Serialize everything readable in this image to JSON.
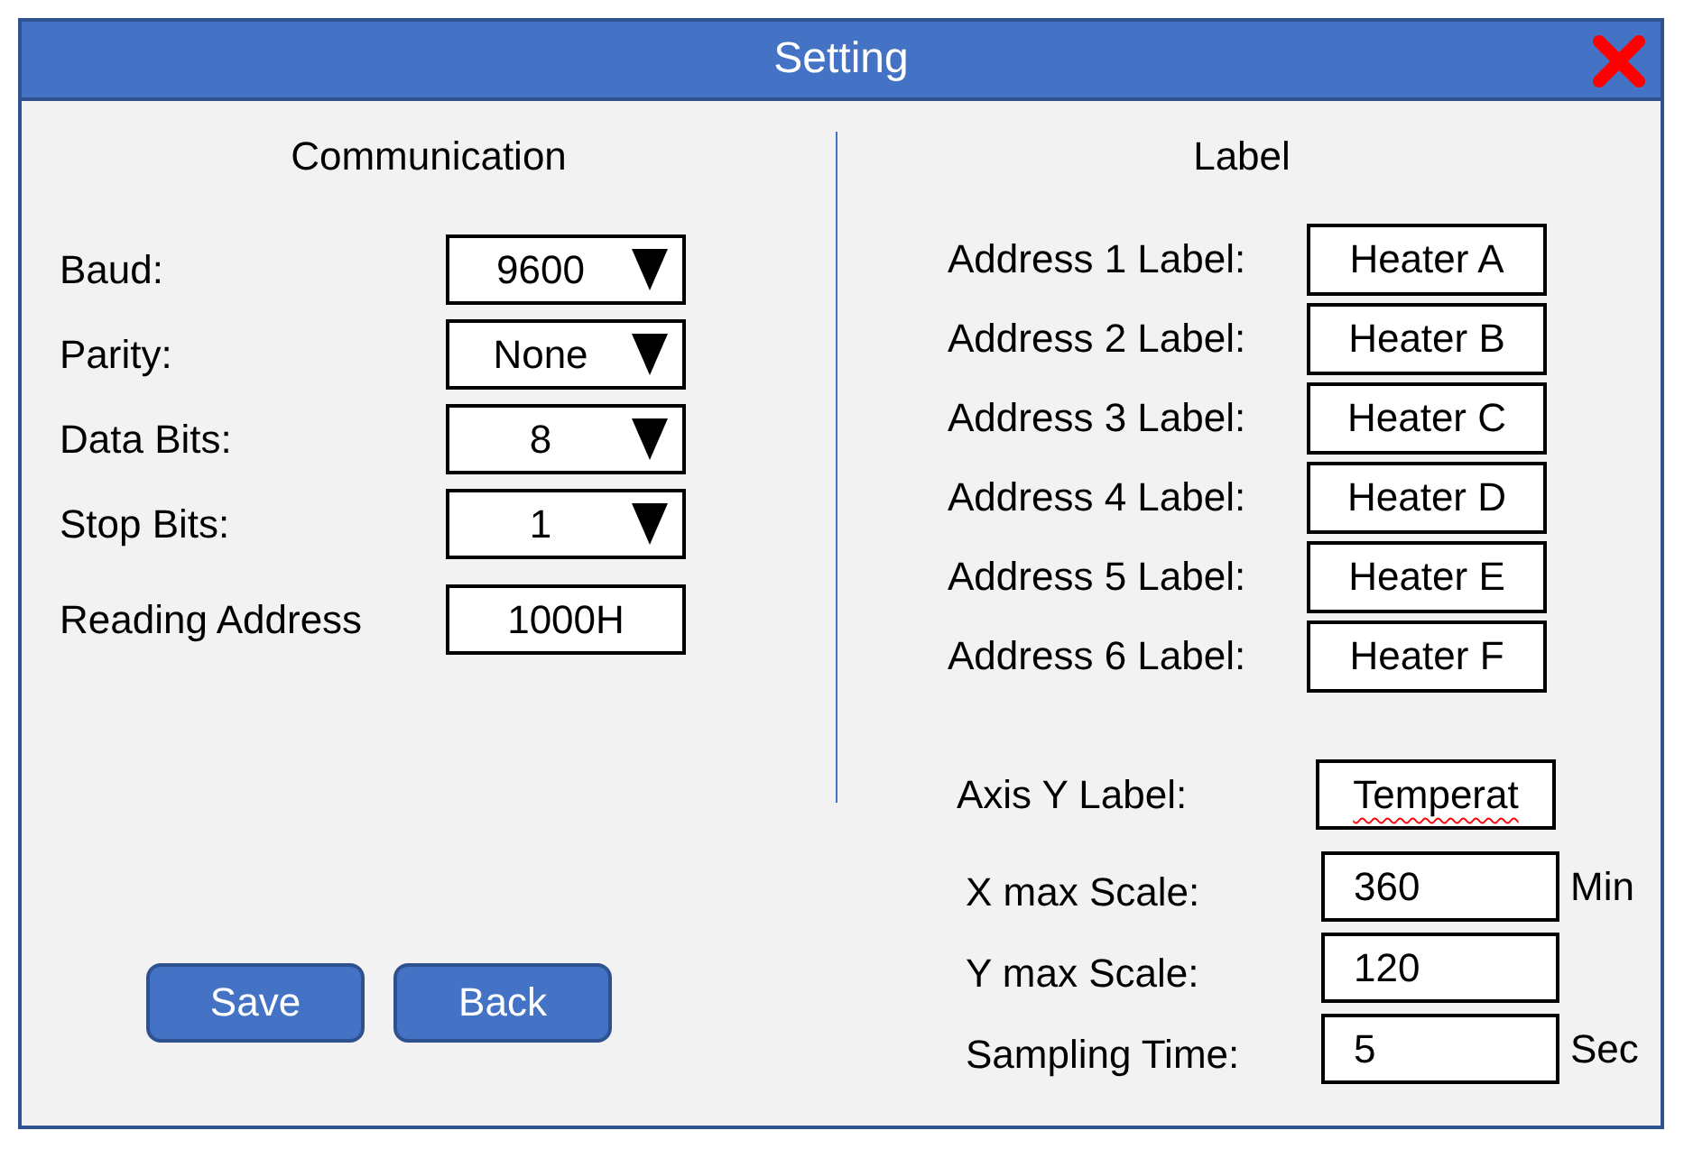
{
  "window": {
    "title": "Setting"
  },
  "communication": {
    "heading": "Communication",
    "fields": [
      {
        "kind": "select",
        "label": "Baud:",
        "value": "9600"
      },
      {
        "kind": "select",
        "label": "Parity:",
        "value": "None"
      },
      {
        "kind": "select",
        "label": "Data Bits:",
        "value": "8"
      },
      {
        "kind": "select",
        "label": "Stop Bits:",
        "value": "1"
      },
      {
        "kind": "text",
        "label": "Reading Address",
        "value": "1000H"
      }
    ]
  },
  "buttons": [
    {
      "label": "Save"
    },
    {
      "label": "Back"
    }
  ],
  "label_section": {
    "heading": "Label",
    "address_labels": [
      {
        "label": "Address 1 Label:",
        "value": "Heater A"
      },
      {
        "label": "Address 2 Label:",
        "value": "Heater B"
      },
      {
        "label": "Address 3 Label:",
        "value": "Heater C"
      },
      {
        "label": "Address 4 Label:",
        "value": "Heater D"
      },
      {
        "label": "Address 5 Label:",
        "value": "Heater E"
      },
      {
        "label": "Address 6 Label:",
        "value": "Heater F"
      }
    ],
    "axis_y": {
      "label": "Axis Y Label:",
      "value": "Temperat",
      "misspelled": true
    },
    "scales": [
      {
        "label": "X max Scale:",
        "value": "360",
        "unit": "Min"
      },
      {
        "label": "Y max Scale:",
        "value": "120"
      },
      {
        "label": "Sampling Time:",
        "value": "5",
        "unit": "Sec"
      }
    ]
  }
}
